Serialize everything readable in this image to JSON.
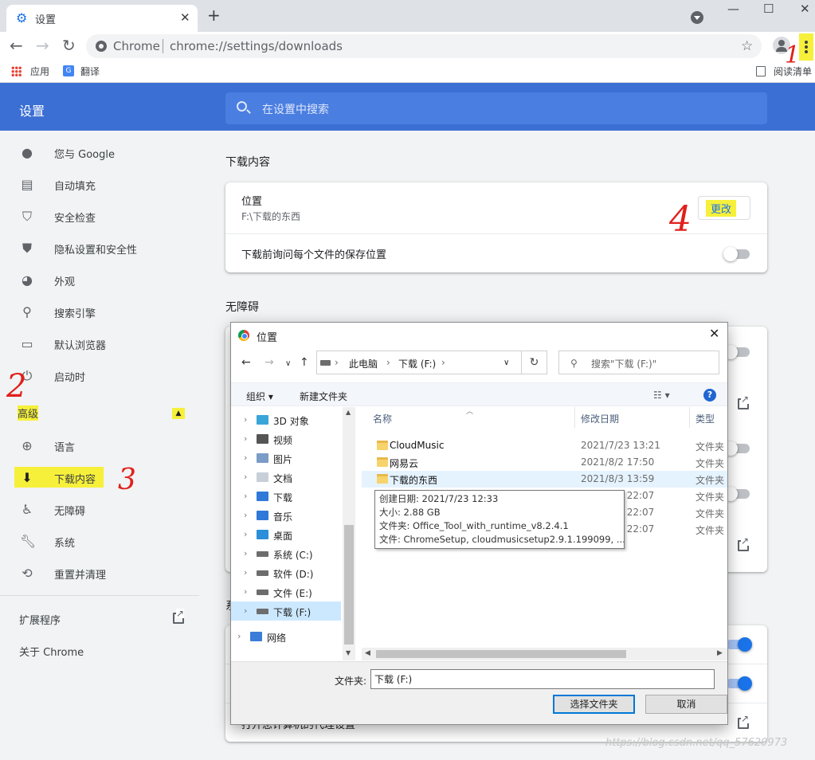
{
  "browser": {
    "tab_title": "设置",
    "tab_close": "✕",
    "new_tab": "+",
    "window_controls": [
      "—",
      "☐",
      "✕"
    ],
    "omnibox_chip": "Chrome",
    "url": "chrome://settings/downloads",
    "bookmarks": {
      "apps": "应用",
      "translate": "翻译",
      "reading_list": "阅读清单"
    }
  },
  "settings": {
    "title": "设置",
    "search_placeholder": "在设置中搜索",
    "sidebar": {
      "items": [
        {
          "label": "您与 Google",
          "icon": "person-icon"
        },
        {
          "label": "自动填充",
          "icon": "clipboard-icon"
        },
        {
          "label": "安全检查",
          "icon": "shield-check-icon"
        },
        {
          "label": "隐私设置和安全性",
          "icon": "shield-icon"
        },
        {
          "label": "外观",
          "icon": "palette-icon"
        },
        {
          "label": "搜索引擎",
          "icon": "search-icon"
        },
        {
          "label": "默认浏览器",
          "icon": "browser-icon"
        },
        {
          "label": "启动时",
          "icon": "power-icon"
        }
      ],
      "advanced": "高级",
      "advanced_items": [
        {
          "label": "语言",
          "icon": "globe-icon"
        },
        {
          "label": "下载内容",
          "icon": "download-icon"
        },
        {
          "label": "无障碍",
          "icon": "accessibility-icon"
        },
        {
          "label": "系统",
          "icon": "wrench-icon"
        },
        {
          "label": "重置并清理",
          "icon": "restore-icon"
        }
      ],
      "extensions": "扩展程序",
      "about": "关于 Chrome"
    },
    "downloads": {
      "section_title": "下载内容",
      "location_label": "位置",
      "location_value": "F:\\下载的东西",
      "change_button": "更改",
      "ask_label": "下载前询问每个文件的保存位置",
      "ask_enabled": false
    },
    "accessibility": {
      "section_title": "无障碍"
    },
    "system": {
      "section_title_fragment": "系",
      "row_text_fragment": "打开您计算机的代理设置",
      "toggles": [
        true,
        true
      ]
    }
  },
  "annotations": [
    "1",
    "2",
    "3",
    "4"
  ],
  "dialog": {
    "title": "位置",
    "close": "✕",
    "address": [
      "此电脑",
      "下载 (F:)"
    ],
    "search_placeholder": "搜索\"下载 (F:)\"",
    "organize": "组织 ▾",
    "new_folder": "新建文件夹",
    "tree": [
      {
        "label": "3D 对象",
        "icon": "3d-objects-icon",
        "color": "#3aa5d8"
      },
      {
        "label": "视频",
        "icon": "video-icon",
        "color": "#555555"
      },
      {
        "label": "图片",
        "icon": "pictures-icon",
        "color": "#7a9cc6"
      },
      {
        "label": "文档",
        "icon": "documents-icon",
        "color": "#c8cfd8"
      },
      {
        "label": "下载",
        "icon": "download-icon",
        "color": "#2f79d8"
      },
      {
        "label": "音乐",
        "icon": "music-icon",
        "color": "#2f79d8"
      },
      {
        "label": "桌面",
        "icon": "desktop-icon",
        "color": "#2a8fd8"
      },
      {
        "label": "系统 (C:)",
        "icon": "drive-icon",
        "color": "#6d6d6d"
      },
      {
        "label": "软件 (D:)",
        "icon": "drive-icon",
        "color": "#6d6d6d"
      },
      {
        "label": "文件 (E:)",
        "icon": "drive-icon",
        "color": "#6d6d6d"
      },
      {
        "label": "下载 (F:)",
        "icon": "drive-icon",
        "color": "#6d6d6d",
        "selected": true
      },
      {
        "label": "网络",
        "icon": "network-icon",
        "color": "#3b7dd8"
      }
    ],
    "columns": {
      "name": "名称",
      "modified": "修改日期",
      "type": "类型"
    },
    "files": [
      {
        "name": "CloudMusic",
        "date": "2021/7/23 13:21",
        "type": "文件夹"
      },
      {
        "name": "网易云",
        "date": "2021/8/2 17:50",
        "type": "文件夹"
      },
      {
        "name": "下载的东西",
        "date": "2021/8/3 13:59",
        "type": "文件夹",
        "hover": true
      },
      {
        "name": "...",
        "date": "2021/8/2 22:07",
        "type": "文件夹"
      },
      {
        "name": "",
        "date": "2021/8/2 22:07",
        "type": "文件夹"
      },
      {
        "name": "",
        "date": "2021/8/2 22:07",
        "type": "文件夹"
      }
    ],
    "tooltip": {
      "created": "创建日期: 2021/7/23 12:33",
      "size": "大小: 2.88 GB",
      "folders": "文件夹: Office_Tool_with_runtime_v8.2.4.1",
      "files": "文件: ChromeSetup, cloudmusicsetup2.9.1.199099, ..."
    },
    "folder_label": "文件夹:",
    "folder_value": "下载 (F:)",
    "select_button": "选择文件夹",
    "cancel_button": "取消"
  },
  "watermark": "https://blog.csdn.net/qq_57620973"
}
